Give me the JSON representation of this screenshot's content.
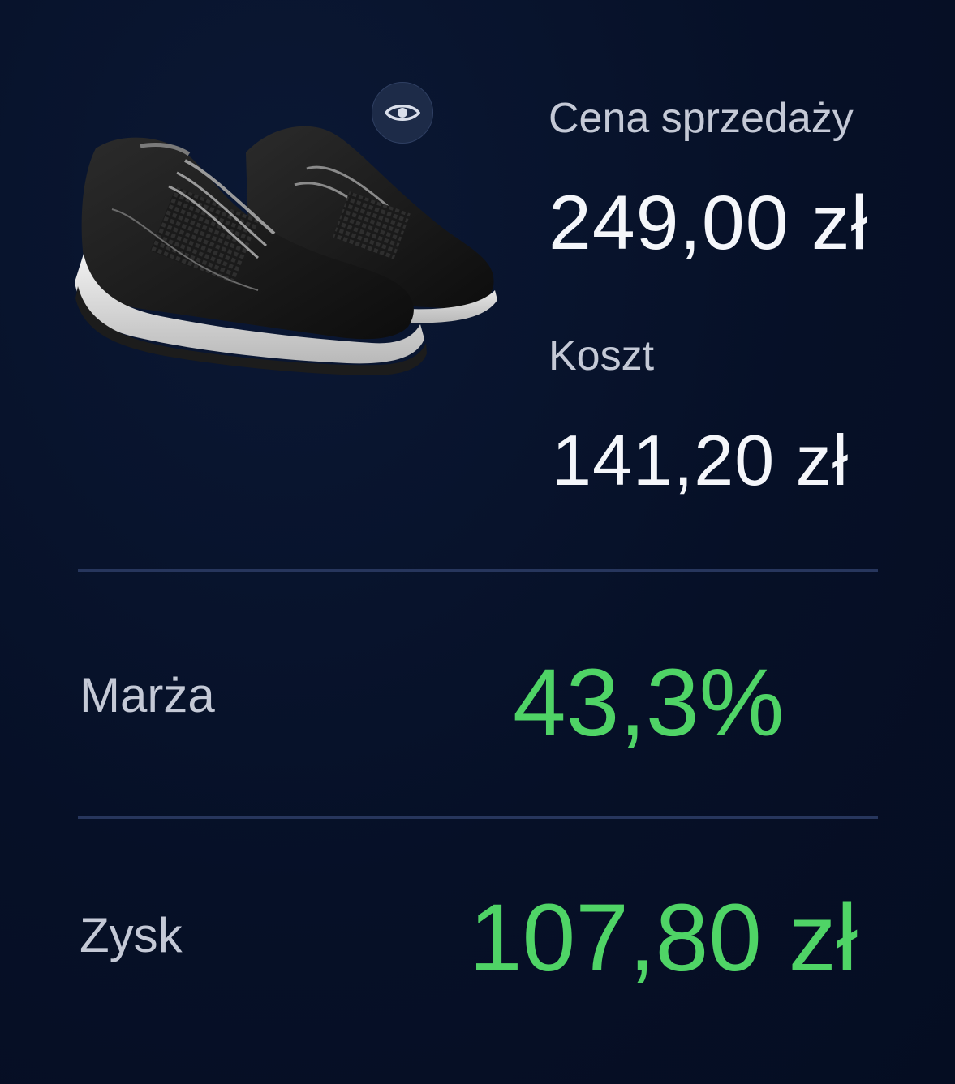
{
  "product": {
    "image_name": "black-sneakers"
  },
  "preview": {
    "icon": "eye-icon"
  },
  "price": {
    "label": "Cena sprzedaży",
    "value": "249,00 zł"
  },
  "cost": {
    "label": "Koszt",
    "value": "141,20 zł"
  },
  "margin": {
    "label": "Marża",
    "value": "43,3%"
  },
  "profit": {
    "label": "Zysk",
    "value": "107,80 zł"
  },
  "colors": {
    "background": "#061027",
    "accent_green": "#4fd466",
    "divider": "#27365d"
  }
}
